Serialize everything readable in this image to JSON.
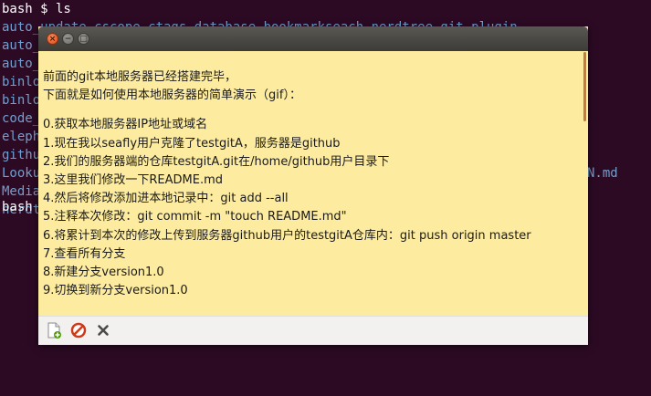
{
  "terminal": {
    "lines": [
      {
        "text": "bash $ ls",
        "color": "#ffffff"
      },
      {
        "text": "auto_update_cscope_ctags_database_bookmarkseach_nerdtree_git_plugin",
        "color": "#729fcf"
      },
      {
        "text": "auto_",
        "color": "#729fcf"
      },
      {
        "text": "auto_",
        "color": "#729fcf"
      },
      {
        "text": "binlo",
        "color": "#729fcf"
      },
      {
        "text": "binlo",
        "color": "#729fcf"
      },
      {
        "text": "code_",
        "color": "#729fcf"
      },
      {
        "text": "eleph",
        "color": "#729fcf"
      },
      {
        "text": "githu",
        "color": "#729fcf"
      },
      {
        "text": "Looku",
        "color": "#729fcf"
      },
      {
        "text": "Media",
        "color": "#729fcf"
      },
      {
        "text": "nerdt",
        "color": "#729fcf"
      },
      {
        "text": "bash $",
        "color": "#ffffff"
      }
    ],
    "right_fragment": "N.md"
  },
  "note": {
    "close_glyph": "×",
    "minimize_glyph": "−",
    "maximize_glyph": "□",
    "intro": [
      "前面的git本地服务器已经搭建完毕，",
      "下面就是如何使用本地服务器的简单演示（gif）："
    ],
    "steps": [
      "0.获取本地服务器IP地址或域名",
      "1.现在我以seafly用户克隆了testgitA，服务器是github",
      "2.我们的服务器端的仓库testgitA.git在/home/github用户目录下",
      "3.这里我们修改一下README.md",
      "4.然后将修改添加进本地记录中：git add --all",
      "5.注释本次修改：git commit -m \"touch README.md\"",
      "6.将累计到本次的修改上传到服务器github用户的testgitA仓库内：git push origin master",
      "7.查看所有分支",
      "8.新建分支version1.0",
      "9.切换到新分支version1.0"
    ]
  },
  "colors": {
    "terminal_bg": "#2c0a24",
    "note_bg": "#fdeca0",
    "scroll_accent": "#c57a42"
  },
  "icons": [
    "new-note-icon",
    "no-entry-icon",
    "delete-icon"
  ]
}
